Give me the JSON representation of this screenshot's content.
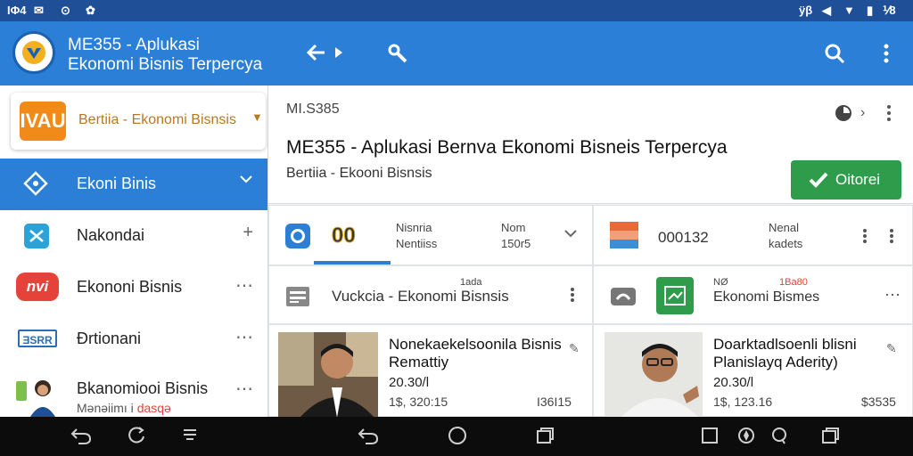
{
  "status_bar": {
    "left": [
      "ΙΦ4",
      "✉",
      "⊙",
      "✿"
    ],
    "right": [
      "ÿβ",
      "◀",
      "▼",
      "▮",
      "⅟8"
    ]
  },
  "app_bar": {
    "title_line1": "ME355 - Aplukasi",
    "title_line2": "Ekonomi Bisnis Terpercya",
    "icons": [
      "back-forward-icon",
      "tool-icon",
      "search-icon",
      "more-vert-icon"
    ]
  },
  "sidebar": {
    "brand": {
      "logo_text": "IVAU",
      "label": "Bertiia - Ekonomi Bisnsis"
    },
    "items": [
      {
        "label": "Ekoni Binis"
      },
      {
        "label": "Nakondai"
      },
      {
        "label": "Ekononi Bisnis",
        "badge": "nvi"
      },
      {
        "label": "Đrtionani",
        "badge": "ƎSRR"
      },
      {
        "label": "Bkanomiooi Bisnis",
        "sublabel": "Mənəiimı i",
        "sublabel_accent": "dasqə"
      }
    ]
  },
  "header": {
    "code": "MI.S385",
    "title": "ME355 - Aplukasi Bernva Ekonomi Bisneis Terpercya",
    "subtitle": "Bertiia - Ekooni Bisnsis",
    "action_button": "Oitorei"
  },
  "left_panel": {
    "tab_value": "00",
    "col1_line1": "Nisnria",
    "col1_line2": "Nentiiss",
    "col2_line1": "Nom",
    "col2_line2": "150r5",
    "row_label": "Vuckcia - Ekonomi Bisnsis",
    "row_superscript": "1ada",
    "news": {
      "title_line1": "Nonekaekelsoonila Bisnis",
      "title_line2": "Remattiy",
      "date": "20.30/l",
      "amount": "1$, 320:15",
      "right_value": "I36I15"
    }
  },
  "right_panel": {
    "code": "000132",
    "col_line1": "Nenal",
    "col_line2": "kadets",
    "row_label": "Ekonomi Bismes",
    "row_super_left": "NØ",
    "row_super_right": "1Ba80",
    "news": {
      "title_line1": "Doarktadlsoenli blisni",
      "title_line2": "Planislayq Aderity)",
      "date": "20.30/l",
      "amount": "1$, 123.16",
      "right_value": "$3535"
    }
  },
  "nav_bar": {
    "icons": [
      "back-icon",
      "refresh-icon",
      "menu-icon",
      "back-icon",
      "home-icon",
      "recents-icon",
      "square-icon",
      "compass-icon",
      "search-icon",
      "recents-icon"
    ]
  },
  "colors": {
    "primary": "#2b7fd6",
    "status_bar": "#1f4f96",
    "accent_green": "#2e9c4b",
    "accent_orange": "#f28a17",
    "badge_red": "#e5433a"
  }
}
